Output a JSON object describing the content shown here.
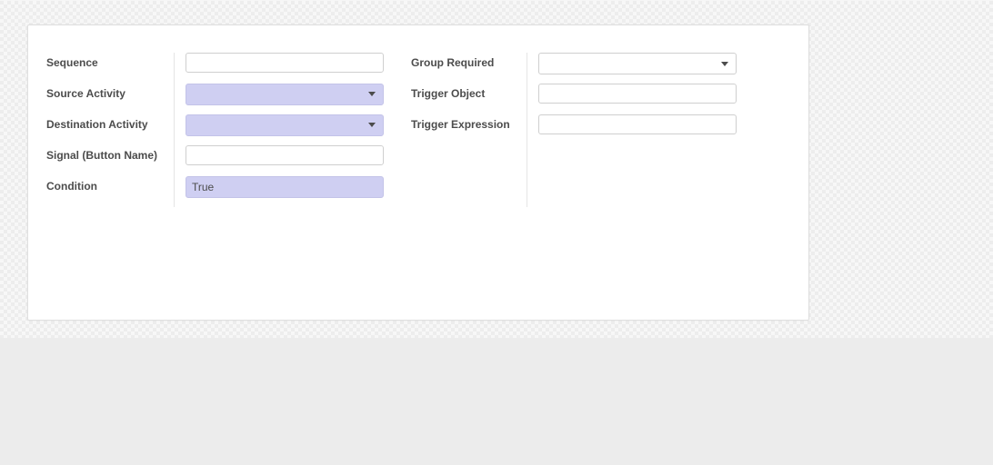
{
  "form": {
    "left": {
      "sequence": {
        "label": "Sequence",
        "value": ""
      },
      "source_activity": {
        "label": "Source Activity",
        "value": ""
      },
      "destination_activity": {
        "label": "Destination Activity",
        "value": ""
      },
      "signal": {
        "label": "Signal (Button Name)",
        "value": ""
      },
      "condition": {
        "label": "Condition",
        "value": "True"
      }
    },
    "right": {
      "group_required": {
        "label": "Group Required",
        "value": ""
      },
      "trigger_object": {
        "label": "Trigger Object",
        "value": ""
      },
      "trigger_expression": {
        "label": "Trigger Expression",
        "value": ""
      }
    }
  }
}
